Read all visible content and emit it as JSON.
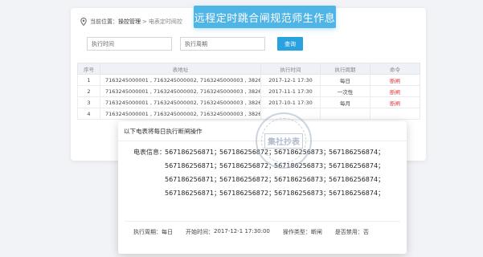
{
  "breadcrumb": {
    "current_label": "当前位置：",
    "items": [
      "操控管理",
      "电表定时阀控"
    ],
    "separator": ">"
  },
  "banner": {
    "text": "远程定时跳合闸规范师生作息"
  },
  "filters": {
    "exec_time_placeholder": "执行时间",
    "exec_cycle_placeholder": "执行周期",
    "query_label": "查询"
  },
  "table": {
    "headers": [
      "序号",
      "表地址",
      "执行时间",
      "执行周期",
      "命令"
    ],
    "rows": [
      {
        "no": "1",
        "addr": "7163245000001 , 7163245000002, 7163245000003 , 3826...",
        "time": "2017-12-1 17:30",
        "cycle": "每日",
        "cmd": "断闸"
      },
      {
        "no": "2",
        "addr": "7163245000001 , 7163245000002, 7163245000003 , 3826...",
        "time": "2017-11-1 17:30",
        "cycle": "一次性",
        "cmd": "断闸"
      },
      {
        "no": "3",
        "addr": "7163245000001 , 7163245000002, 7163245000003 , 3826...",
        "time": "2017-10-1 17:30",
        "cycle": "每月",
        "cmd": "断闸"
      },
      {
        "no": "4",
        "addr": "7163245000001 , 7163245000002, 7163245000003 , 3826...",
        "time": "",
        "cycle": "",
        "cmd": ""
      }
    ]
  },
  "watermark": {
    "text": "集社抄表"
  },
  "dialog": {
    "title": "以下电表将每日执行断闸操作",
    "meter_label": "电表信息：",
    "meter_rows": [
      [
        "567186256871；",
        "567186256872；",
        "567186256873；",
        "567186256874；"
      ],
      [
        "567186256871；",
        "567186256872；",
        "567186256873；",
        "567186256874；"
      ],
      [
        "567186256871；",
        "567186256872；",
        "567186256873；",
        "567186256874；"
      ],
      [
        "567186256871；",
        "567186256872；",
        "567186256873；",
        "567186256874；"
      ]
    ],
    "footer": {
      "cycle_label": "执行周期：",
      "cycle_value": "每日",
      "start_label": "开始时间：",
      "start_value": "2017-12-1 17:30:00",
      "op_label": "操作类型：",
      "op_value": "断闸",
      "disable_label": "是否禁用：",
      "disable_value": "否"
    }
  },
  "colors": {
    "banner": "#4fb4e6",
    "query_button": "#29a3e0",
    "command_red": "#e23b3b"
  },
  "icons": {
    "location": "location-pin-icon"
  }
}
